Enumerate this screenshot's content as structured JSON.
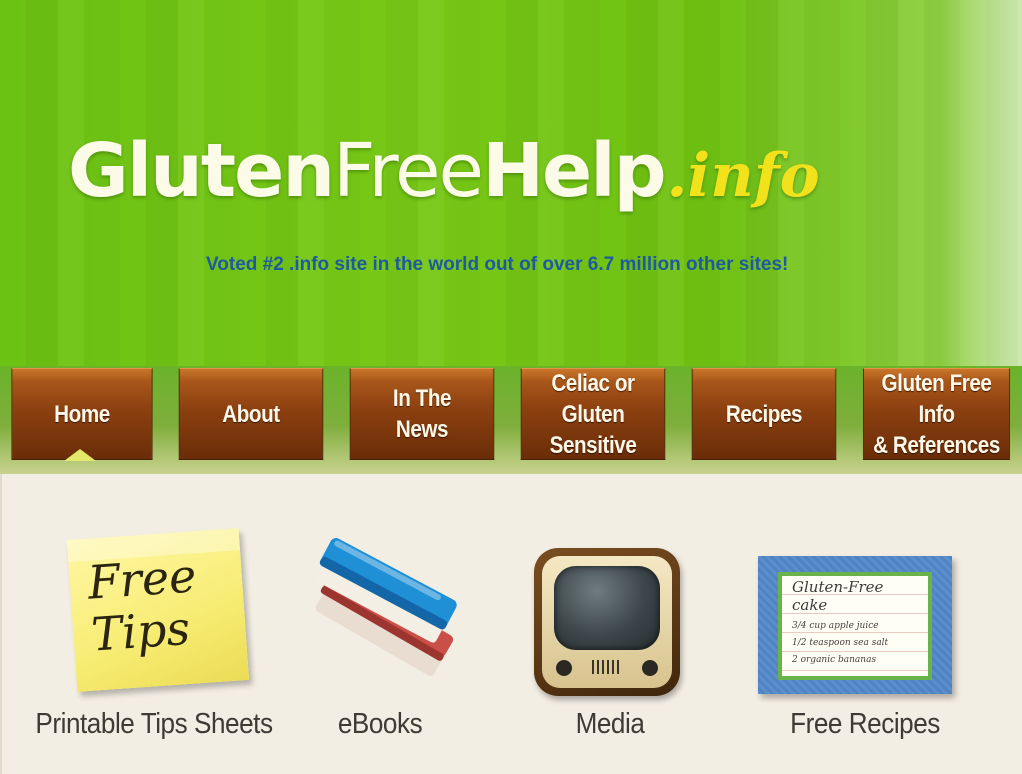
{
  "header": {
    "logo": {
      "part_gluten": "Gluten",
      "part_free": "Free",
      "part_help": "Help",
      "part_info": ".info"
    },
    "tagline": "Voted #2 .info site in the world out of over 6.7 million other sites!"
  },
  "nav": {
    "items": [
      {
        "label": "Home",
        "active": true
      },
      {
        "label": "About"
      },
      {
        "label": "In The\nNews"
      },
      {
        "label": "Celiac or Gluten\nSensitive"
      },
      {
        "label": "Recipes"
      },
      {
        "label": "Gluten Free Info\n& References"
      }
    ]
  },
  "features": [
    {
      "label": "Printable Tips Sheets",
      "icon": "sticky-note-icon",
      "art_text": "Free\nTips"
    },
    {
      "label": "eBooks",
      "icon": "books-icon"
    },
    {
      "label": "Media",
      "icon": "tv-icon"
    },
    {
      "label": "Free Recipes",
      "icon": "recipe-card-icon",
      "card_title": "Gluten-Free cake",
      "card_lines": [
        "3/4 cup apple juice",
        "1/2 teaspoon sea salt",
        "2 organic bananas"
      ]
    }
  ],
  "colors": {
    "header_green": "#72c414",
    "tagline_blue": "#1e5aa0",
    "logo_accent_yellow": "#f2e21c",
    "nav_brown": "#8c4010",
    "content_bg": "#f3eee3"
  }
}
